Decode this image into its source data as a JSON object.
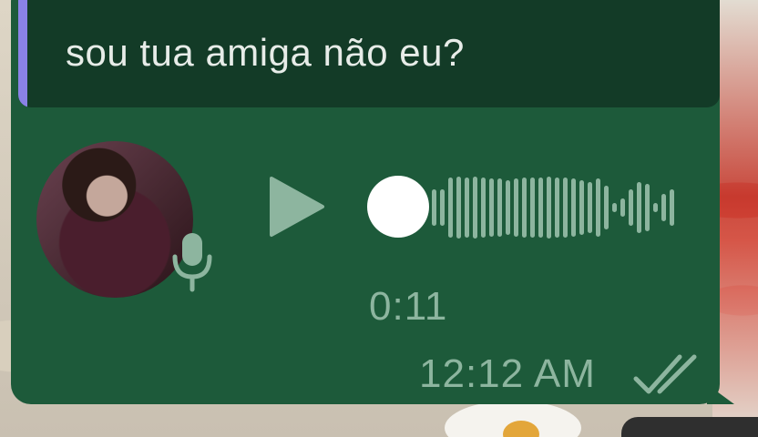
{
  "quoted_message": {
    "text": "sou tua amiga não eu?"
  },
  "voice_message": {
    "duration": "0:11",
    "progress": 0,
    "icons": {
      "play": "play-icon",
      "mic": "microphone-icon",
      "avatar": "avatar-photo"
    }
  },
  "meta": {
    "timestamp": "12:12 AM",
    "status_icon": "double-check-icon"
  },
  "colors": {
    "bubble": "#1d5a3a",
    "quote_bg": "#133b27",
    "quote_bar": "#8a82e6",
    "text": "#e7ece8",
    "muted": "#8db59f"
  }
}
